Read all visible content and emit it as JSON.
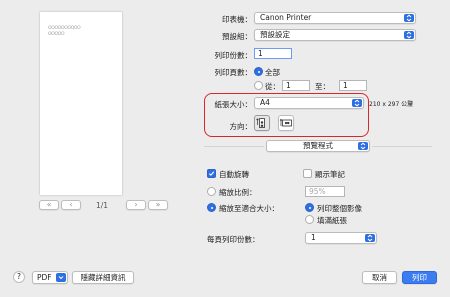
{
  "preview": {
    "page_lines": [
      "OOOOOOOOOO",
      "OOOOO"
    ],
    "nav_first": "«",
    "nav_prev": "‹",
    "nav_next": "›",
    "nav_last": "»",
    "page_indicator": "1/1"
  },
  "printer": {
    "label": "印表機：",
    "value": "Canon Printer"
  },
  "presets": {
    "label": "預設組：",
    "value": "預設設定"
  },
  "copies": {
    "label": "列印份數：",
    "value": "1"
  },
  "pages": {
    "label": "列印頁數：",
    "all_label": "全部",
    "from_label": "從：",
    "from_value": "1",
    "to_label": "至：",
    "to_value": "1"
  },
  "paper": {
    "label": "紙張大小：",
    "value": "A4",
    "dimensions": "210 x 297 公釐"
  },
  "orientation": {
    "label": "方向："
  },
  "app_section": {
    "value": "預覽程式"
  },
  "auto_rotate": {
    "label": "自動旋轉",
    "checked": true
  },
  "show_notes": {
    "label": "顯示筆記",
    "checked": false
  },
  "scale": {
    "label": "縮放比例：",
    "value": "95%"
  },
  "scale_to_fit": {
    "label": "縮放至適合大小：",
    "print_entire_label": "列印整個影像",
    "fill_paper_label": "填滿紙張"
  },
  "pages_per_sheet": {
    "label": "每頁列印份數：",
    "value": "1"
  },
  "footer": {
    "help": "?",
    "pdf": "PDF",
    "hide_details": "隱藏詳細資訊",
    "cancel": "取消",
    "print": "列印"
  },
  "colors": {
    "accent": "#2f6fe4",
    "highlight_oval": "#d9262a"
  }
}
